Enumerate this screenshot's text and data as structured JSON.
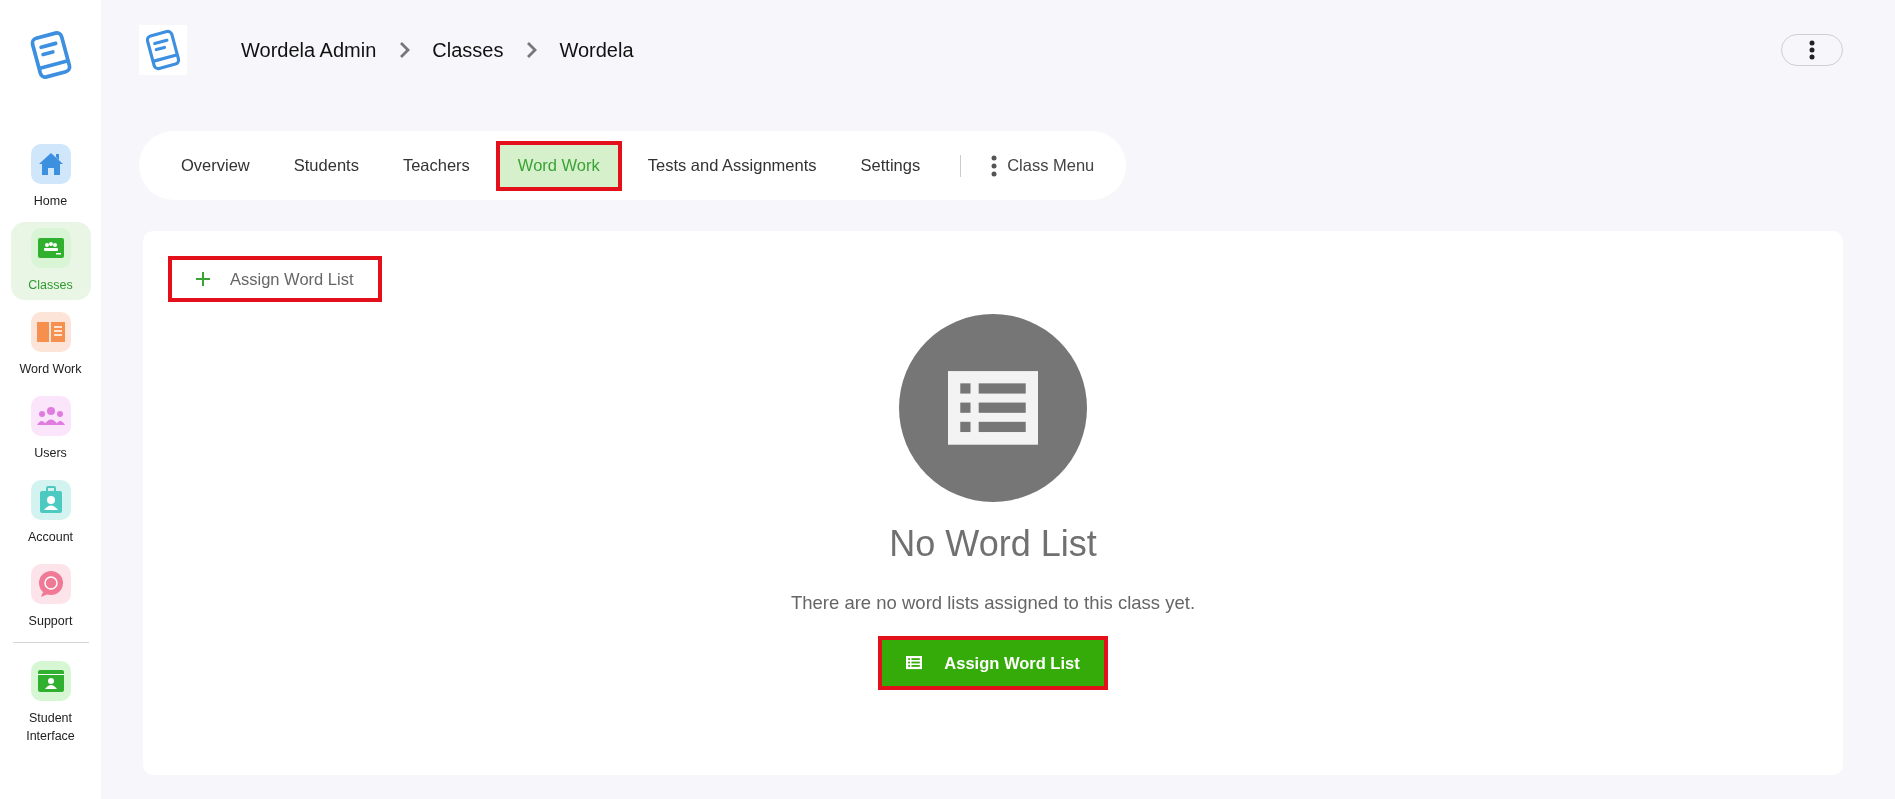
{
  "sidebar": {
    "items": [
      {
        "kind": "home",
        "label": "Home",
        "selected": false
      },
      {
        "kind": "classes",
        "label": "Classes",
        "selected": true
      },
      {
        "kind": "wordwork",
        "label": "Word Work",
        "selected": false
      },
      {
        "kind": "users",
        "label": "Users",
        "selected": false
      },
      {
        "kind": "account",
        "label": "Account",
        "selected": false
      },
      {
        "kind": "support",
        "label": "Support",
        "selected": false
      },
      {
        "kind": "student",
        "label": "Student Interface",
        "selected": false
      }
    ]
  },
  "breadcrumb": [
    "Wordela Admin",
    "Classes",
    "Wordela"
  ],
  "tabs": [
    {
      "label": "Overview",
      "selected": false,
      "highlighted": false
    },
    {
      "label": "Students",
      "selected": false,
      "highlighted": false
    },
    {
      "label": "Teachers",
      "selected": false,
      "highlighted": false
    },
    {
      "label": "Word Work",
      "selected": true,
      "highlighted": true
    },
    {
      "label": "Tests and Assignments",
      "selected": false,
      "highlighted": false
    },
    {
      "label": "Settings",
      "selected": false,
      "highlighted": false
    }
  ],
  "class_menu": {
    "label": "Class Menu"
  },
  "assign_button": {
    "label": "Assign Word List",
    "highlighted": true
  },
  "empty_state": {
    "title": "No Word List",
    "message": "There are no word lists assigned to this class yet.",
    "button": {
      "label": "Assign Word List",
      "highlighted": true
    }
  }
}
